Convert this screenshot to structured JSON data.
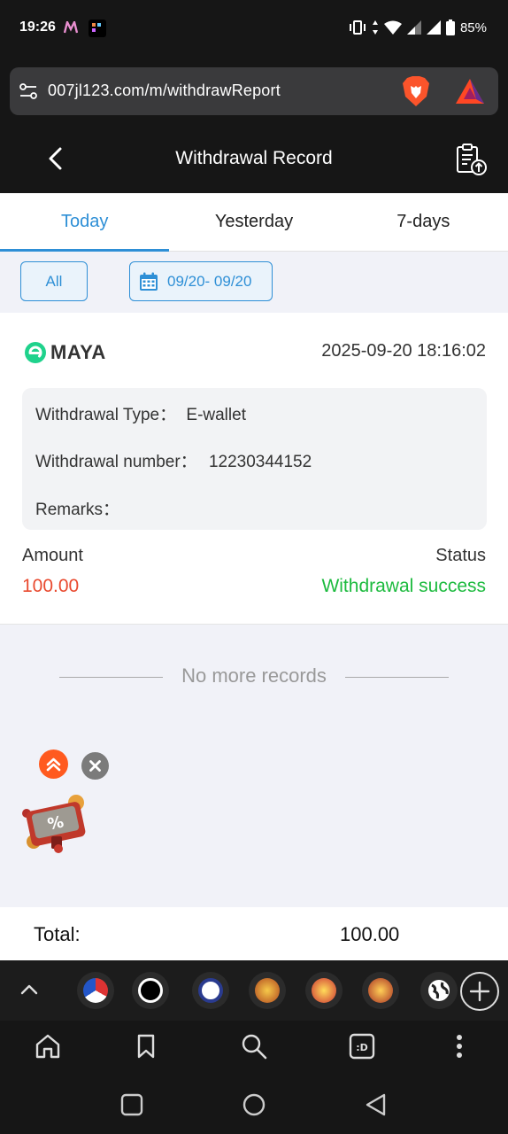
{
  "status_bar": {
    "time": "19:26",
    "battery": "85%"
  },
  "browser": {
    "url": "007jl123.com/m/withdrawReport"
  },
  "header": {
    "title": "Withdrawal Record"
  },
  "tabs": [
    {
      "label": "Today",
      "active": true
    },
    {
      "label": "Yesterday",
      "active": false
    },
    {
      "label": "7-days",
      "active": false
    }
  ],
  "filters": {
    "all_label": "All",
    "date_range": "09/20- 09/20"
  },
  "record": {
    "provider": "MAYA",
    "datetime": "2025-09-20 18:16:02",
    "withdrawal_type_label": "Withdrawal Type：",
    "withdrawal_type_value": "E-wallet",
    "withdrawal_number_label": "Withdrawal number：",
    "withdrawal_number_value": "12230344152",
    "remarks_label": "Remarks：",
    "remarks_value": "",
    "amount_label": "Amount",
    "amount_value": "100.00",
    "status_label": "Status",
    "status_value": "Withdrawal success"
  },
  "list_end_text": "No more records",
  "total": {
    "label": "Total:",
    "value": "100.00"
  },
  "colors": {
    "accent": "#2e8fd6",
    "amount": "#e94a2f",
    "success": "#1dbb3f",
    "dark_bar": "#161616"
  }
}
